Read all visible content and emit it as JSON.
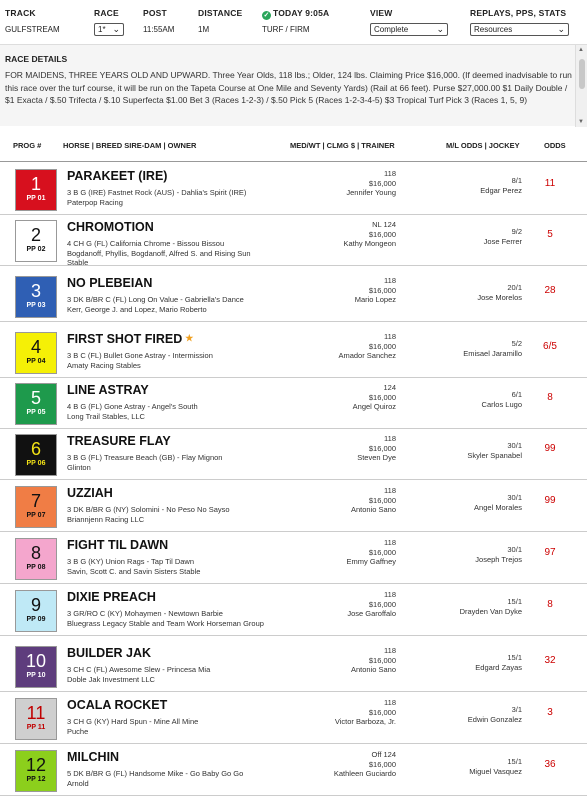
{
  "header": {
    "track_label": "TRACK",
    "track_value": "GULFSTREAM",
    "race_label": "RACE",
    "race_value": "1*",
    "post_label": "POST",
    "post_value": "11:55AM",
    "distance_label": "DISTANCE",
    "distance_value": "1M",
    "today_label": "TODAY 9:05A",
    "surface_value": "TURF / FIRM",
    "view_label": "VIEW",
    "view_value": "Complete",
    "replays_label": "REPLAYS, PPS, STATS",
    "replays_value": "Resources"
  },
  "race_details": {
    "title": "RACE DETAILS",
    "text": "FOR MAIDENS, THREE YEARS OLD AND UPWARD. Three Year Olds, 118 lbs.; Older, 124 lbs. Claiming Price $16,000. (If deemed inadvisable to run this race over the turf course, it will be run on the Tapeta Course at One Mile and Seventy Yards) (Rail at 66 feet). Purse $27,000.00 $1 Daily Double / $1 Exacta / $.50 Trifecta / $.10 Superfecta $1.00 Bet 3 (Races 1-2-3) / $.50 Pick 5 (Races 1-2-3-4-5) $3 Tropical Turf Pick 3 (Races 1, 5, 9)"
  },
  "columns": {
    "prog": "PROG #",
    "horse": "HORSE | BREED SIRE-DAM | OWNER",
    "med": "MED/WT | CLMG $ | TRAINER",
    "ml": "M/L ODDS | JOCKEY",
    "odds": "ODDS"
  },
  "entries": [
    {
      "num": "1",
      "pp": "PP 01",
      "bg": "#d7101e",
      "fg": "#ffffff",
      "name": "PARAKEET (IRE)",
      "star": false,
      "breed": "3 B G (IRE) Fastnet Rock (AUS) - Dahlia's Spirit (IRE)",
      "owner": "Paterpop Racing",
      "med": "118",
      "clm": "$16,000",
      "trainer": "Jennifer Young",
      "ml": "8/1",
      "jockey": "Edgar Perez",
      "odds": "11"
    },
    {
      "num": "2",
      "pp": "PP 02",
      "bg": "#ffffff",
      "fg": "#111111",
      "name": "CHROMOTION",
      "star": false,
      "breed": "4 CH G (FL) California Chrome - Bissou Bissou",
      "owner": "Bogdanoff, Phyllis, Bogdanoff, Alfred S. and Rising Sun Stable",
      "med": "NL 124",
      "clm": "$16,000",
      "trainer": "Kathy Mongeon",
      "ml": "9/2",
      "jockey": "Jose Ferrer",
      "odds": "5"
    },
    {
      "num": "3",
      "pp": "PP 03",
      "bg": "#2f5fb4",
      "fg": "#ffffff",
      "name": "NO PLEBEIAN",
      "star": false,
      "breed": "3 DK B/BR C (FL) Long On Value - Gabriella's Dance",
      "owner": "Kerr, George J. and Lopez, Mario Roberto",
      "med": "118",
      "clm": "$16,000",
      "trainer": "Mario Lopez",
      "ml": "20/1",
      "jockey": "Jose Morelos",
      "odds": "28"
    },
    {
      "num": "4",
      "pp": "PP 04",
      "bg": "#f5f006",
      "fg": "#111111",
      "name": "FIRST SHOT FIRED",
      "star": true,
      "breed": "3 B C (FL) Bullet Gone Astray - Intermission",
      "owner": "Amaty Racing Stables",
      "med": "118",
      "clm": "$16,000",
      "trainer": "Amador Sanchez",
      "ml": "5/2",
      "jockey": "Emisael Jaramillo",
      "odds": "6/5"
    },
    {
      "num": "5",
      "pp": "PP 05",
      "bg": "#1e9a4c",
      "fg": "#ffffff",
      "name": "LINE ASTRAY",
      "star": false,
      "breed": "4 B G (FL) Gone Astray - Angel's South",
      "owner": "Long Trail Stables, LLC",
      "med": "124",
      "clm": "$16,000",
      "trainer": "Angel Quiroz",
      "ml": "6/1",
      "jockey": "Carlos Lugo",
      "odds": "8"
    },
    {
      "num": "6",
      "pp": "PP 06",
      "bg": "#111111",
      "fg": "#f2e216",
      "name": "TREASURE FLAY",
      "star": false,
      "breed": "3 B G (FL) Treasure Beach (GB) - Flay Mignon",
      "owner": "Glinton",
      "med": "118",
      "clm": "$16,000",
      "trainer": "Steven Dye",
      "ml": "30/1",
      "jockey": "Skyler Spanabel",
      "odds": "99"
    },
    {
      "num": "7",
      "pp": "PP 07",
      "bg": "#f07d45",
      "fg": "#111111",
      "name": "UZZIAH",
      "star": false,
      "breed": "3 DK B/BR G (NY) Solomini - No Peso No Sayso",
      "owner": "Briannjenn Racing LLC",
      "med": "118",
      "clm": "$16,000",
      "trainer": "Antonio Sano",
      "ml": "30/1",
      "jockey": "Angel Morales",
      "odds": "99"
    },
    {
      "num": "8",
      "pp": "PP 08",
      "bg": "#f4a6cd",
      "fg": "#111111",
      "name": "FIGHT TIL DAWN",
      "star": false,
      "breed": "3 B G (KY) Union Rags - Tap Til Dawn",
      "owner": "Savin, Scott C. and Savin Sisters Stable",
      "med": "118",
      "clm": "$16,000",
      "trainer": "Emmy Gaffney",
      "ml": "30/1",
      "jockey": "Joseph Trejos",
      "odds": "97"
    },
    {
      "num": "9",
      "pp": "PP 09",
      "bg": "#bfe9f6",
      "fg": "#111111",
      "name": "DIXIE PREACH",
      "star": false,
      "breed": "3 GR/RO C (KY) Mohaymen - Newtown Barbie",
      "owner": "Bluegrass Legacy Stable and Team Work Horseman Group",
      "med": "118",
      "clm": "$16,000",
      "trainer": "Jose Garoffalo",
      "ml": "15/1",
      "jockey": "Drayden Van Dyke",
      "odds": "8"
    },
    {
      "num": "10",
      "pp": "PP 10",
      "bg": "#5e3d7d",
      "fg": "#ffffff",
      "name": "BUILDER JAK",
      "star": false,
      "breed": "3 CH C (FL) Awesome Slew - Princesa Mia",
      "owner": "Doble Jak Investment LLC",
      "med": "118",
      "clm": "$16,000",
      "trainer": "Antonio Sano",
      "ml": "15/1",
      "jockey": "Edgard Zayas",
      "odds": "32"
    },
    {
      "num": "11",
      "pp": "PP 11",
      "bg": "#cfcfcf",
      "fg": "#c00000",
      "name": "OCALA ROCKET",
      "star": false,
      "breed": "3 CH G (KY) Hard Spun - Mine All Mine",
      "owner": "Puche",
      "med": "118",
      "clm": "$16,000",
      "trainer": "Victor Barboza, Jr.",
      "ml": "3/1",
      "jockey": "Edwin Gonzalez",
      "odds": "3"
    },
    {
      "num": "12",
      "pp": "PP 12",
      "bg": "#8ccf1c",
      "fg": "#111111",
      "name": "MILCHIN",
      "star": false,
      "breed": "5 DK B/BR G (FL) Handsome Mike - Go Baby Go Go",
      "owner": "Arnold",
      "med": "Off 124",
      "clm": "$16,000",
      "trainer": "Kathleen Guciardo",
      "ml": "15/1",
      "jockey": "Miguel Vasquez",
      "odds": "36"
    }
  ]
}
